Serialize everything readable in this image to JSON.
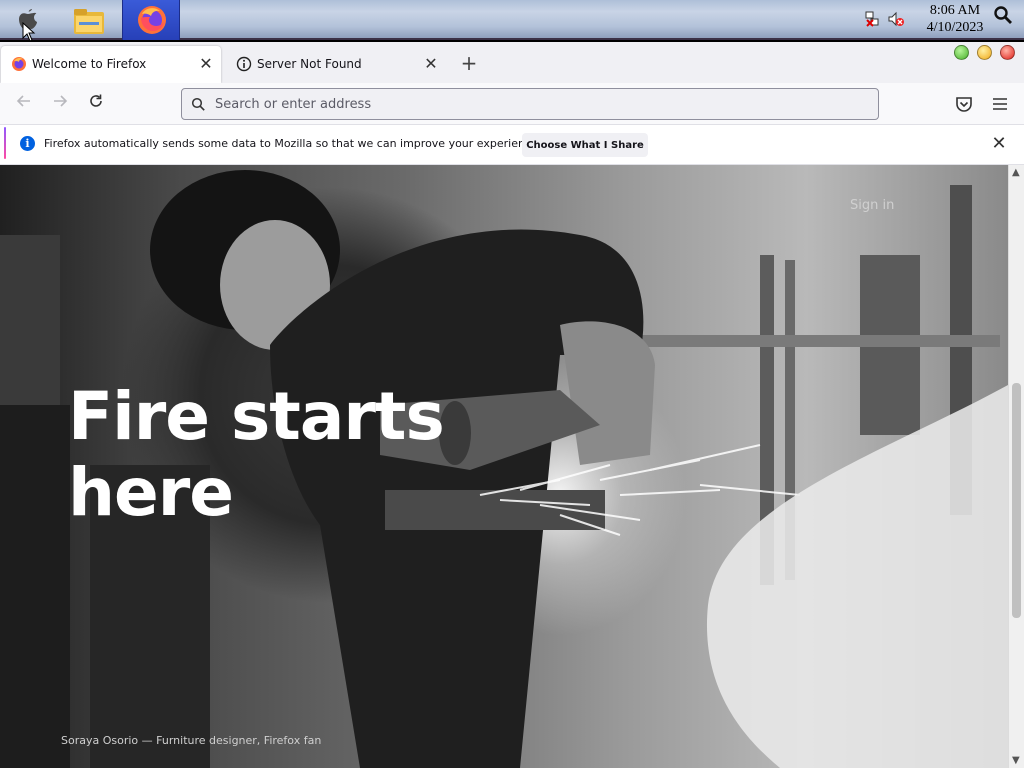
{
  "taskbar": {
    "apple_icon": "apple-logo-icon",
    "folder_icon": "file-manager-icon",
    "firefox_icon": "firefox-icon",
    "clock_time": "8:06 AM",
    "clock_date": "4/10/2023",
    "network_icon": "network-disconnected-icon",
    "volume_icon": "volume-muted-icon",
    "search_icon": "search-icon"
  },
  "tabs": [
    {
      "title": "Welcome to Firefox",
      "icon": "firefox-icon",
      "active": true
    },
    {
      "title": "Server Not Found",
      "icon": "info-icon",
      "active": false
    }
  ],
  "window_controls": {
    "minimize": "#48b02a",
    "maximize": "#f0a818",
    "close": "#e0211a"
  },
  "navbar": {
    "search_placeholder": "Search or enter address",
    "back_icon": "arrow-left-icon",
    "forward_icon": "arrow-right-icon",
    "reload_icon": "reload-icon",
    "pocket_icon": "pocket-icon",
    "menu_icon": "hamburger-menu-icon"
  },
  "notification": {
    "text": "Firefox automatically sends some data to Mozilla so that we can improve your experience.",
    "button_label": "Choose What I Share",
    "accent_color": "#0061e0"
  },
  "page": {
    "sign_in": "Sign in",
    "headline_line1": "Fire starts",
    "headline_line2": "here",
    "photo_credit": "Soraya Osorio — Furniture designer, Firefox fan"
  },
  "colors": {
    "brand_firefox": "#ff7139",
    "taskbar_active": "#2740b8"
  }
}
